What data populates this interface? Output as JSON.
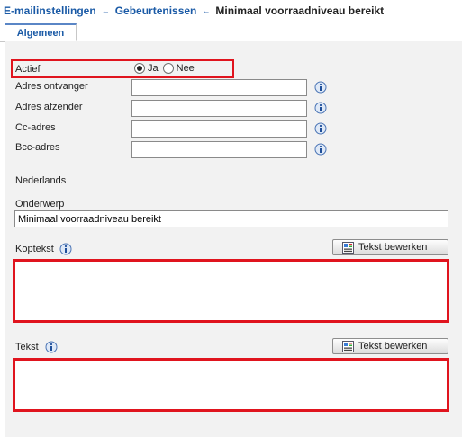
{
  "breadcrumb": {
    "items": [
      "E-mailinstellingen",
      "Gebeurtenissen"
    ],
    "current": "Minimaal voorraadniveau bereikt",
    "separator": "←"
  },
  "tabs": [
    {
      "label": "Algemeen",
      "active": true
    }
  ],
  "form": {
    "active": {
      "label": "Actief",
      "options": [
        "Ja",
        "Nee"
      ],
      "selected": "Ja"
    },
    "recipient_label": "Adres ontvanger",
    "recipient_value": "",
    "sender_label": "Adres afzender",
    "sender_value": "",
    "cc_label": "Cc-adres",
    "cc_value": "",
    "bcc_label": "Bcc-adres",
    "bcc_value": "",
    "language_heading": "Nederlands",
    "subject_label": "Onderwerp",
    "subject_value": "Minimaal voorraadniveau bereikt",
    "header_text_label": "Koptekst",
    "body_text_label": "Tekst",
    "edit_text_button": "Tekst bewerken"
  },
  "colors": {
    "link": "#1a5aa6",
    "highlight": "#e0141e",
    "panel_bg": "#f2f2f2"
  },
  "icons": [
    "info-icon",
    "edit-document-icon",
    "breadcrumb-arrow-icon"
  ]
}
